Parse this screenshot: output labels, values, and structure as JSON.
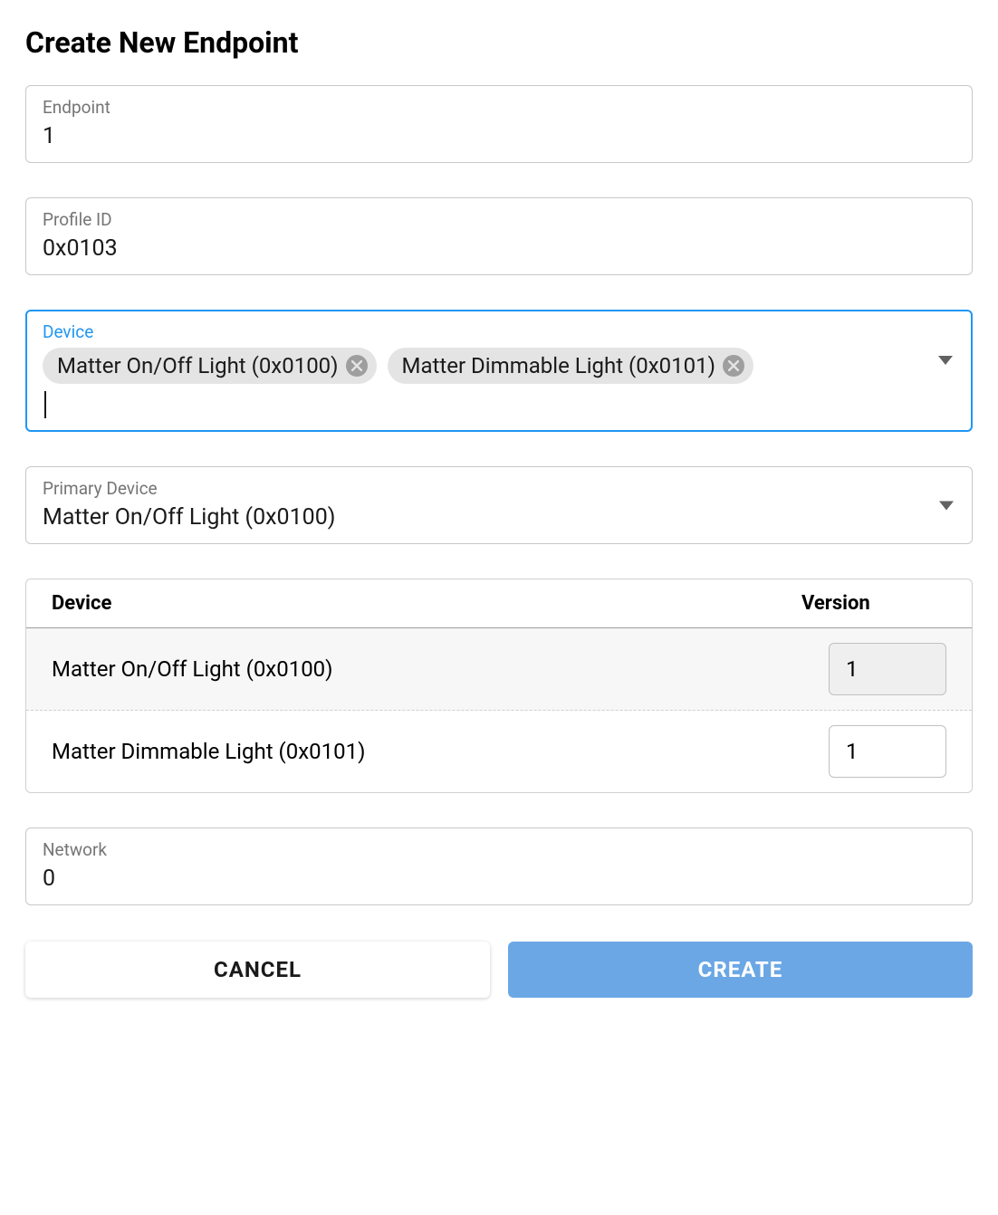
{
  "title": "Create New Endpoint",
  "fields": {
    "endpoint": {
      "label": "Endpoint",
      "value": "1"
    },
    "profile_id": {
      "label": "Profile ID",
      "value": "0x0103"
    },
    "device": {
      "label": "Device",
      "chips": [
        "Matter On/Off Light (0x0100)",
        "Matter Dimmable Light (0x0101)"
      ]
    },
    "primary_device": {
      "label": "Primary Device",
      "value": "Matter On/Off Light (0x0100)"
    },
    "network": {
      "label": "Network",
      "value": "0"
    }
  },
  "table": {
    "headers": {
      "device": "Device",
      "version": "Version"
    },
    "rows": [
      {
        "device": "Matter On/Off Light (0x0100)",
        "version": "1"
      },
      {
        "device": "Matter Dimmable Light (0x0101)",
        "version": "1"
      }
    ]
  },
  "buttons": {
    "cancel": "CANCEL",
    "create": "CREATE"
  }
}
